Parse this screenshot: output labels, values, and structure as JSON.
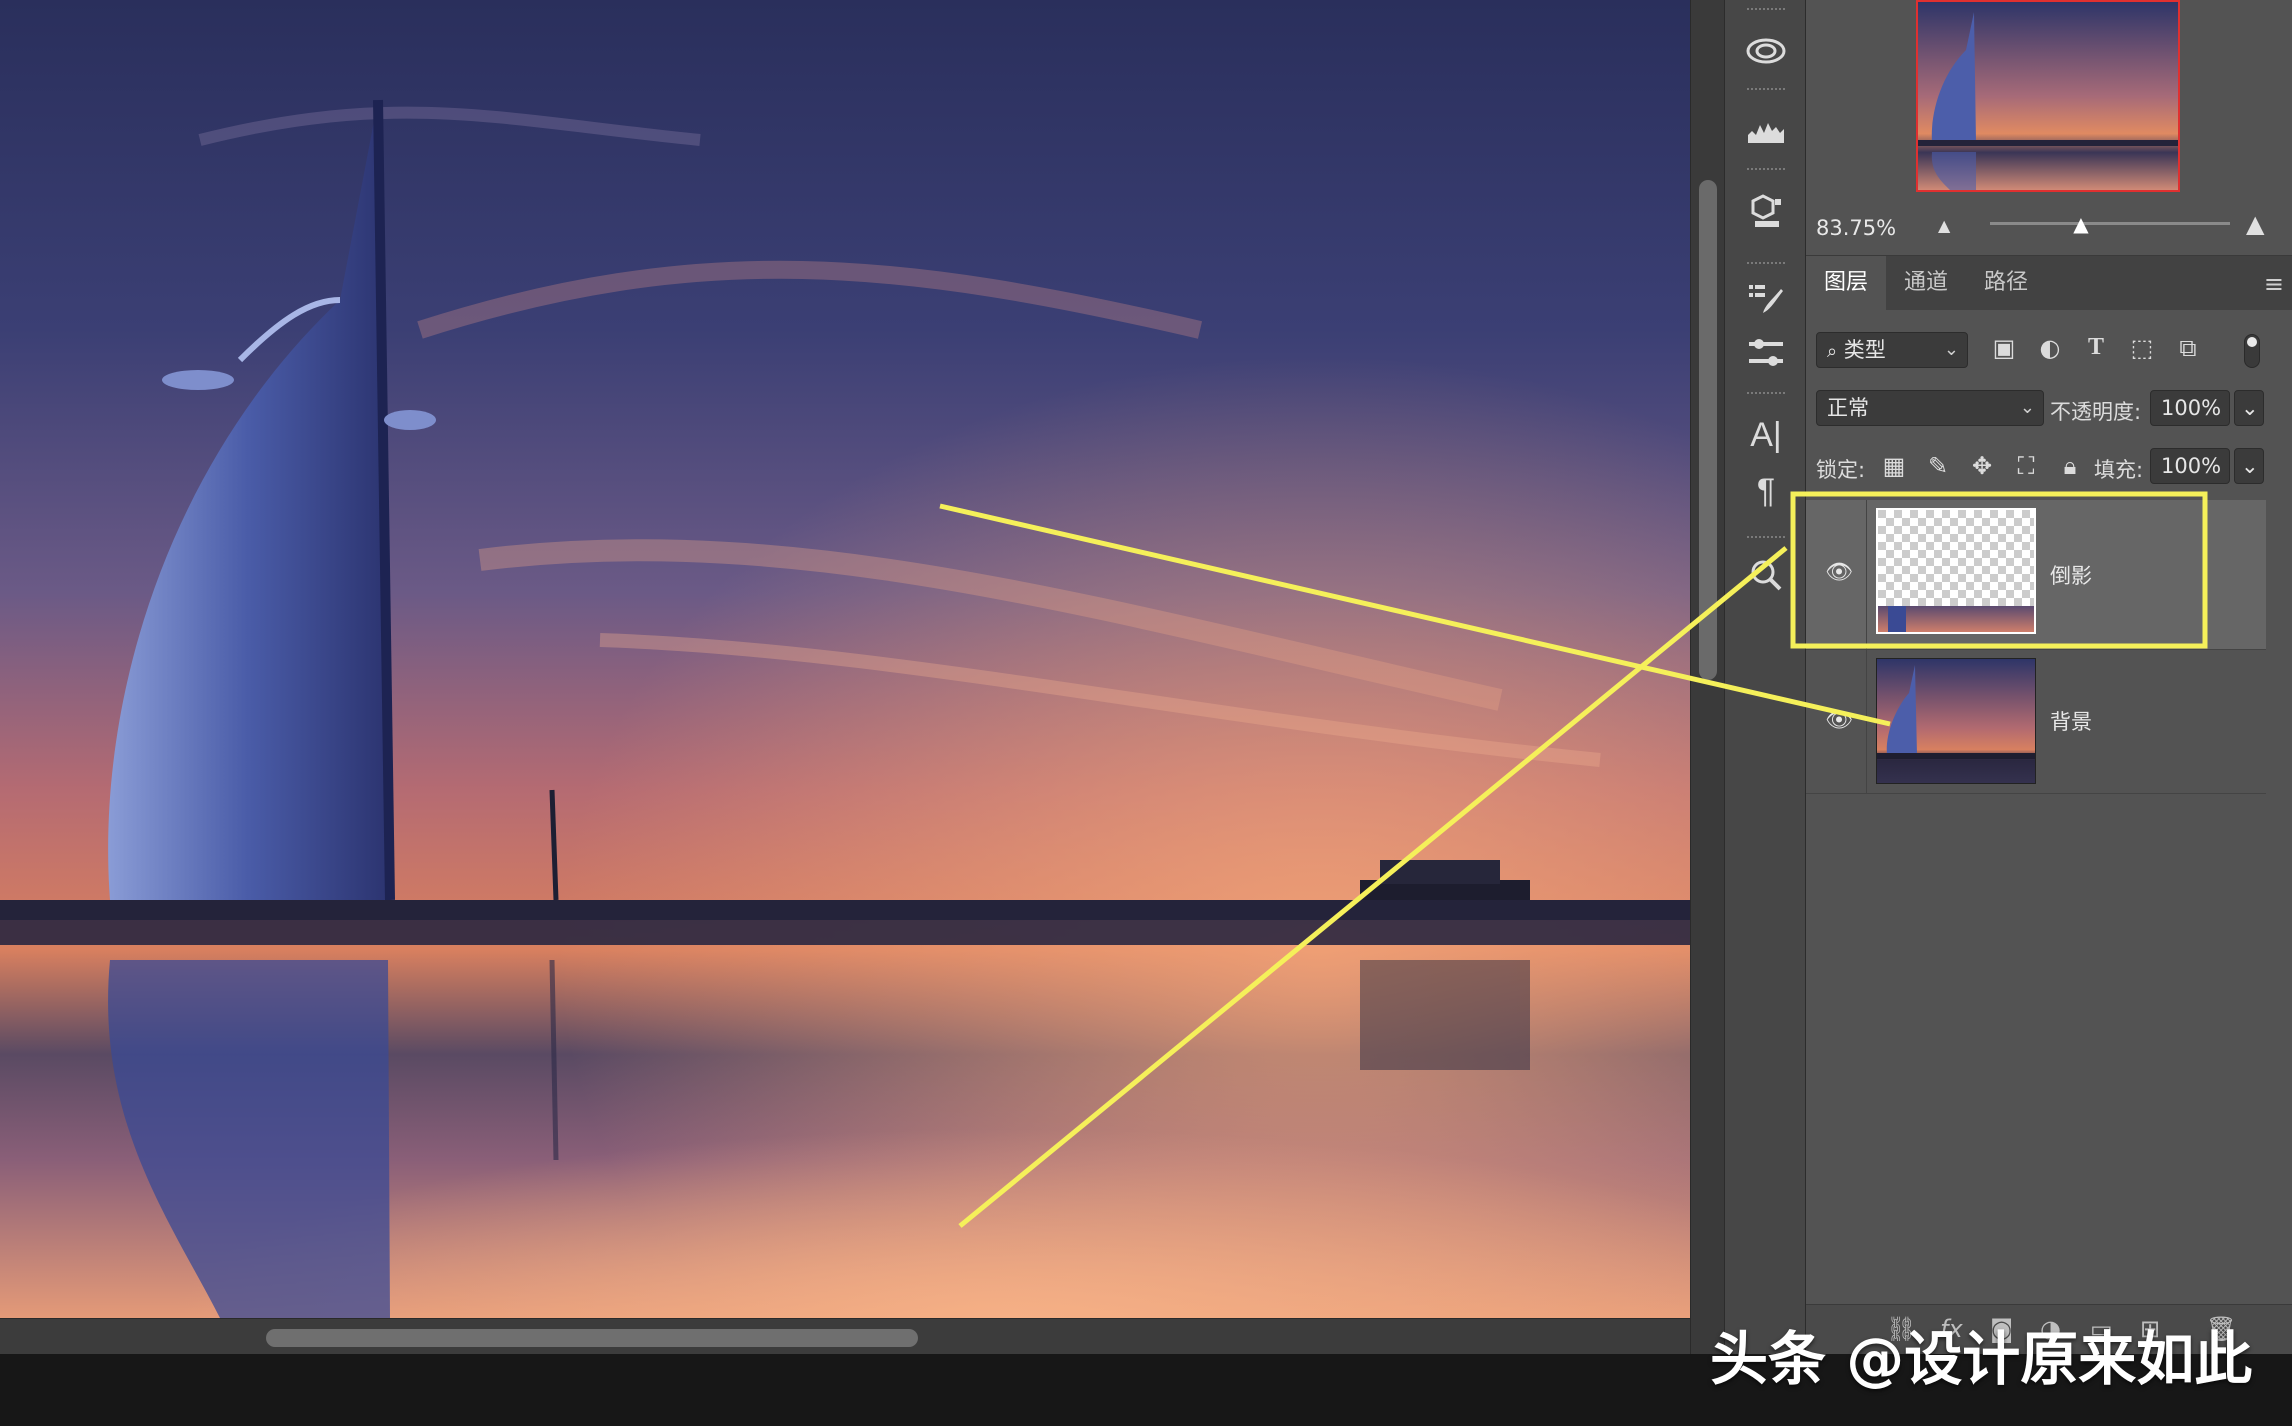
{
  "navigator": {
    "zoom": "83.75%"
  },
  "layers_panel": {
    "tabs": [
      "图层",
      "通道",
      "路径"
    ],
    "filter_label": "类型",
    "blend_mode": "正常",
    "opacity_label": "不透明度:",
    "opacity_value": "100%",
    "lock_label": "锁定:",
    "fill_label": "填充:",
    "fill_value": "100%",
    "layers": [
      {
        "name": "倒影",
        "visible": true,
        "selected": true
      },
      {
        "name": "背景",
        "visible": true,
        "selected": false
      }
    ]
  },
  "tools": [
    "creative-cloud-icon",
    "histogram-icon",
    "3d-icon",
    "brush-presets-icon",
    "adjustments-icon",
    "character-icon",
    "paragraph-icon",
    "search-icon"
  ],
  "watermark": "头条 @设计原来如此",
  "colors": {
    "annotation_yellow": "#f5f05a",
    "selection_red": "#e03030",
    "panel_bg": "#535353"
  }
}
